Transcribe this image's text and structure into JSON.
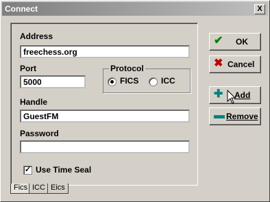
{
  "window": {
    "title": "Connect",
    "close_label": "X"
  },
  "form": {
    "address_label": "Address",
    "address_value": "freechess.org",
    "port_label": "Port",
    "port_value": "5000",
    "protocol_label": "Protocol",
    "protocol_options": [
      "FICS",
      "ICC"
    ],
    "protocol_selected": "FICS",
    "handle_label": "Handle",
    "handle_value": "GuestFM",
    "password_label": "Password",
    "password_value": "",
    "timeseal_label": "Use Time Seal",
    "timeseal_checked": true
  },
  "buttons": {
    "ok": "OK",
    "cancel": "Cancel",
    "add": "Add",
    "remove": "Remove"
  },
  "tabs": [
    "Fics",
    "ICC",
    "Eics"
  ],
  "colors": {
    "ok_icon": "#008000",
    "cancel_icon": "#c00000",
    "add_icon": "#008080",
    "remove_icon": "#008080"
  }
}
